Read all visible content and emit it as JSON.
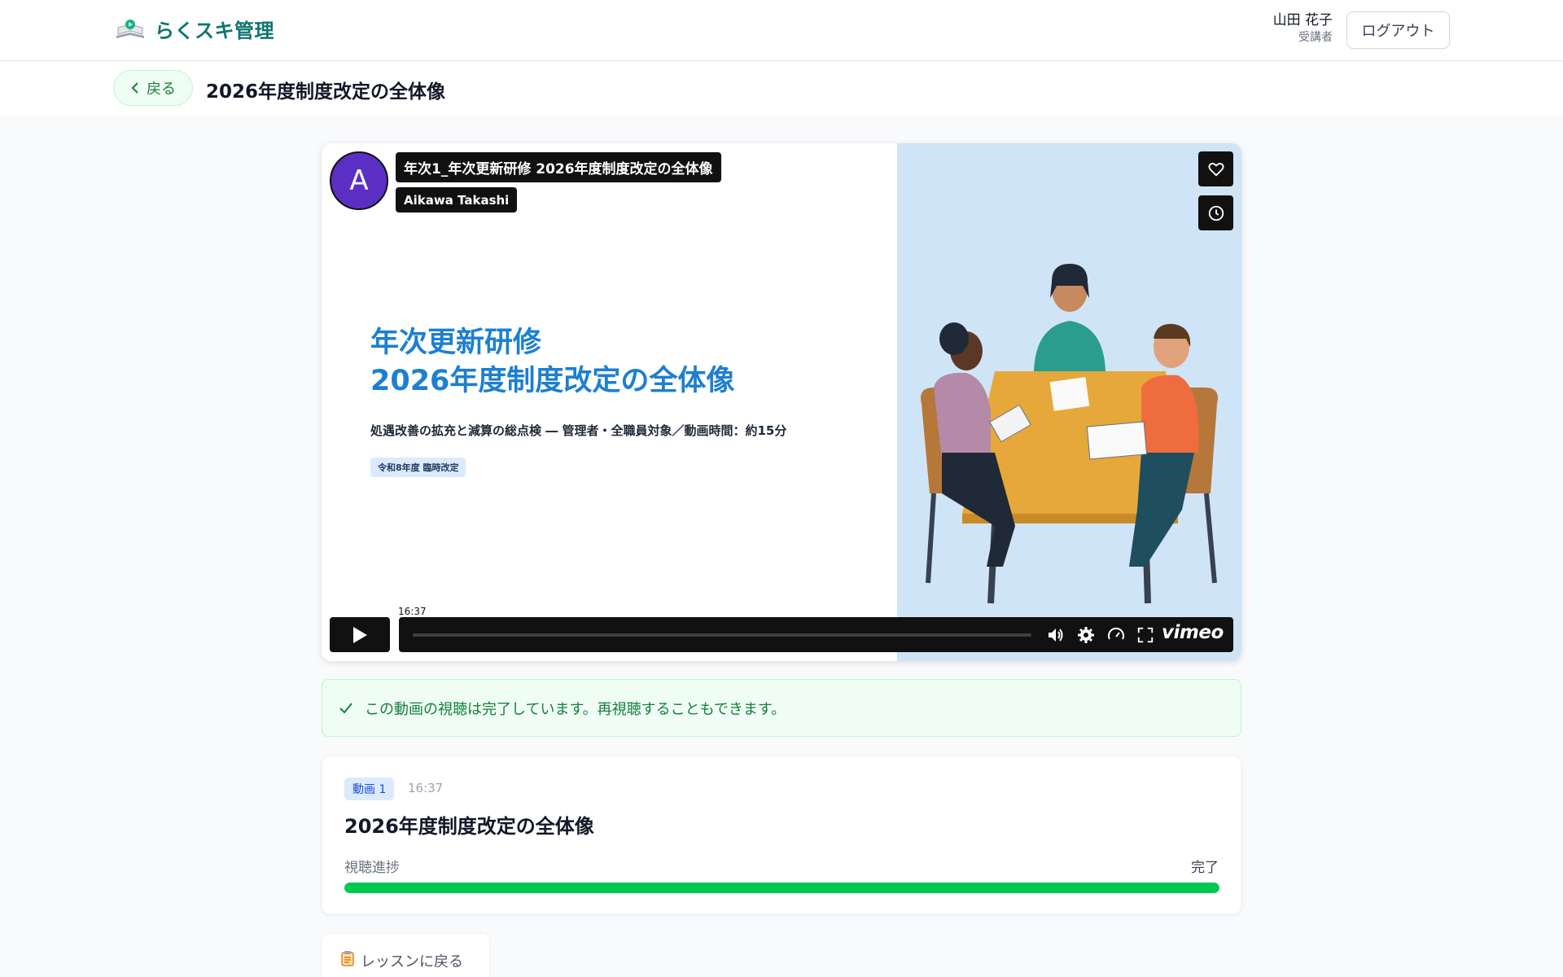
{
  "header": {
    "brand_name": "らくスキ管理",
    "user_name": "山田 花子",
    "user_role": "受講者",
    "logout_label": "ログアウト"
  },
  "subheader": {
    "back_label": "戻る",
    "page_title": "2026年度制度改定の全体像"
  },
  "player": {
    "avatar_letter": "A",
    "video_title": "年次1_年次更新研修 2026年度制度改定の全体像",
    "author": "Aikawa Takashi",
    "slide_heading_line1": "年次更新研修",
    "slide_heading_line2": "2026年度制度改定の全体像",
    "slide_subtitle": "処遇改善の拡充と減算の総点検 ― 管理者・全職員対象／動画時間：約15分",
    "slide_tag": "令和8年度 臨時改定",
    "time_tooltip": "16:37",
    "vimeo_label": "vimeo",
    "icons": [
      "heart-icon",
      "clock-icon",
      "play-icon",
      "volume-icon",
      "settings-icon",
      "speed-icon",
      "fullscreen-icon"
    ]
  },
  "notice": {
    "text": "この動画の視聴は完了しています。再視聴することもできます。"
  },
  "card": {
    "badge": "動画 1",
    "duration": "16:37",
    "title": "2026年度制度改定の全体像",
    "progress_label": "視聴進捗",
    "progress_status": "完了",
    "progress_percent": 100
  },
  "footer": {
    "lesson_back_label": "レッスンに戻る"
  },
  "colors": {
    "brand": "#0f766e",
    "accent_blue": "#1d7fd1",
    "success": "#00c853"
  }
}
